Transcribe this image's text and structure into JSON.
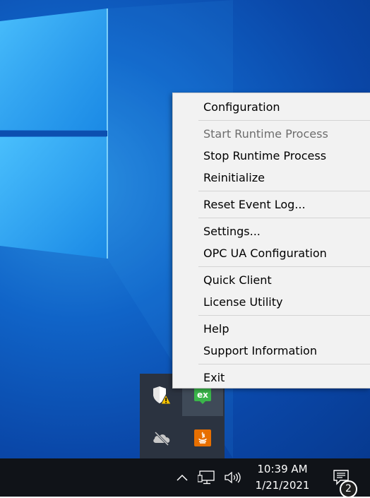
{
  "menu": {
    "items": [
      {
        "label": "Configuration",
        "enabled": true
      },
      {
        "sep": true
      },
      {
        "label": "Start Runtime Process",
        "enabled": false
      },
      {
        "label": "Stop Runtime Process",
        "enabled": true
      },
      {
        "label": "Reinitialize",
        "enabled": true
      },
      {
        "sep": true
      },
      {
        "label": "Reset Event Log...",
        "enabled": true
      },
      {
        "sep": true
      },
      {
        "label": "Settings...",
        "enabled": true
      },
      {
        "label": "OPC UA Configuration",
        "enabled": true
      },
      {
        "sep": true
      },
      {
        "label": "Quick Client",
        "enabled": true
      },
      {
        "label": "License Utility",
        "enabled": true
      },
      {
        "sep": true
      },
      {
        "label": "Help",
        "enabled": true
      },
      {
        "label": "Support Information",
        "enabled": true
      },
      {
        "sep": true
      },
      {
        "label": "Exit",
        "enabled": true
      }
    ]
  },
  "tray_popup": {
    "icons": [
      {
        "name": "windows-security-warning-icon",
        "color": "#ffffff"
      },
      {
        "name": "kepserverex-icon",
        "label": "ex",
        "color": "#3ab54a"
      },
      {
        "name": "onedrive-offline-icon",
        "color": "#c0c0c0"
      },
      {
        "name": "java-update-icon",
        "color": "#e76f00"
      }
    ]
  },
  "taskbar": {
    "time": "10:39 AM",
    "date": "1/21/2021",
    "notification_count": "2"
  }
}
